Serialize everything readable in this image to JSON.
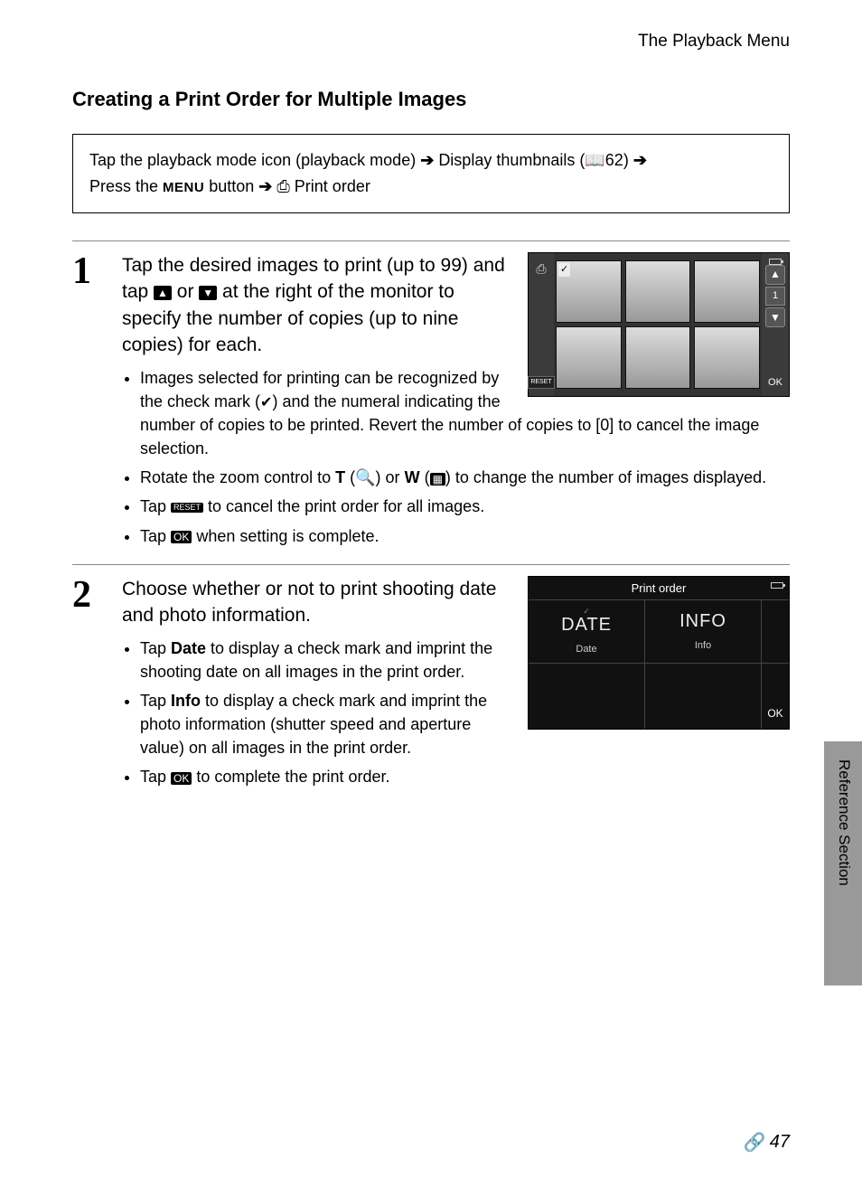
{
  "header": {
    "section": "The Playback Menu"
  },
  "title": "Creating a Print Order for Multiple Images",
  "navbox": {
    "l1a": "Tap the playback mode icon (playback mode) ",
    "l1b": " Display thumbnails (",
    "l1c": "62) ",
    "l2a": "Press the ",
    "l2menu": "MENU",
    "l2b": " button ",
    "l2c": " Print order"
  },
  "step1": {
    "num": "1",
    "lead_a": "Tap the desired images to print (up to 99) and tap ",
    "lead_b": " or ",
    "lead_c": " at the right of the monitor to specify the number of copies (up to nine copies) for each.",
    "b1": "Images selected for printing can be recognized by the check mark (",
    "b1b": ") and the numeral indicating the number of copies to be printed. Revert the number of copies to [0] to cancel the image selection.",
    "b2a": "Rotate the zoom control to ",
    "b2T": "T",
    "b2b": " (",
    "b2c": ") or ",
    "b2W": "W",
    "b2d": " (",
    "b2e": ") to change the number of images displayed.",
    "b3a": "Tap ",
    "b3b": " to cancel the print order for all images.",
    "b4a": "Tap ",
    "b4b": " when setting is complete."
  },
  "screen1": {
    "count": "1",
    "reset": "RESET",
    "ok": "OK"
  },
  "step2": {
    "num": "2",
    "lead": "Choose whether or not to print shooting date and photo information.",
    "b1a": "Tap ",
    "b1bold": "Date",
    "b1b": " to display a check mark and imprint the shooting date on all images in the print order.",
    "b2a": "Tap ",
    "b2bold": "Info",
    "b2b": " to display a check mark and imprint the photo information (shutter speed and aperture value) on all images in the print order.",
    "b3a": "Tap ",
    "b3b": " to complete the print order."
  },
  "screen2": {
    "title": "Print order",
    "date_big": "DATE",
    "date_sub": "Date",
    "info_big": "INFO",
    "info_sub": "Info",
    "ok": "OK"
  },
  "side": {
    "label": "Reference Section"
  },
  "pagenum": "47"
}
